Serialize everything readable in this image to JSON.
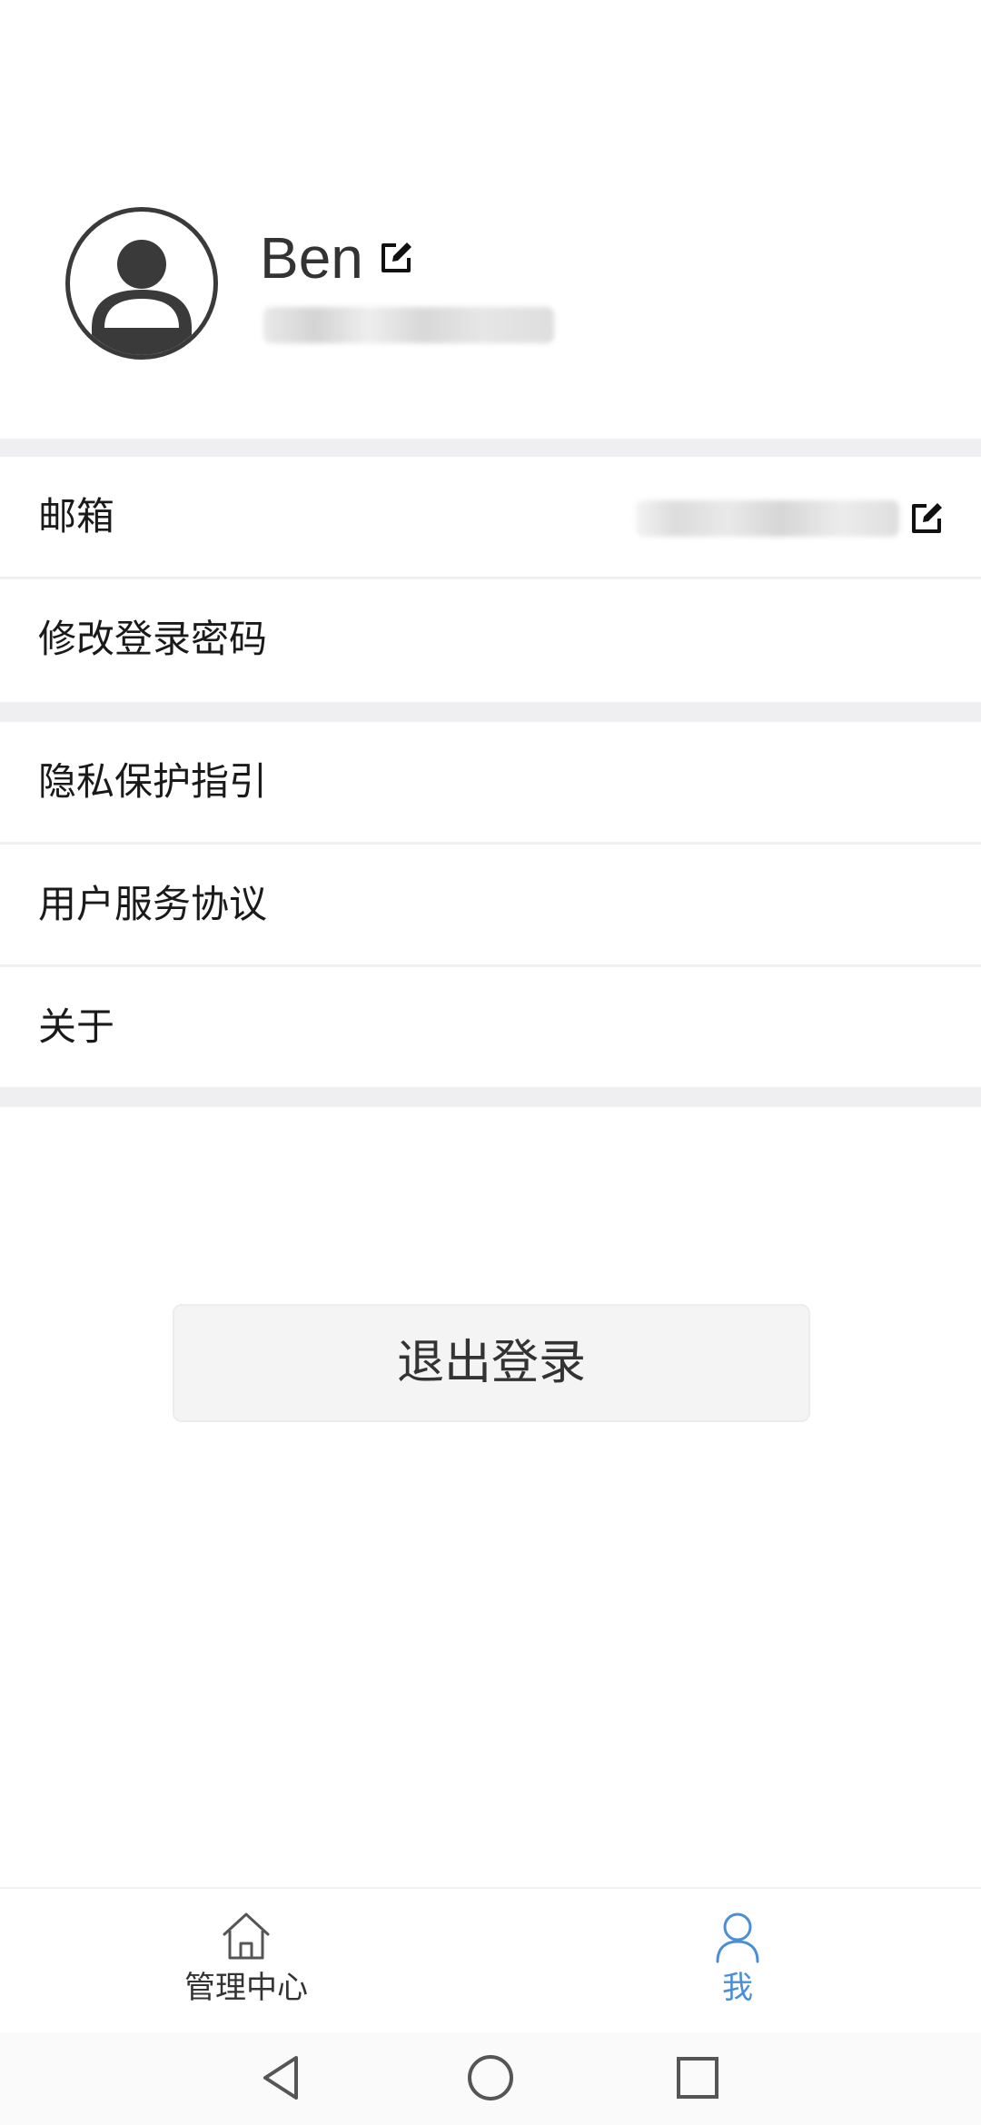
{
  "profile": {
    "username": "Ben",
    "avatar_icon": "user-avatar-icon",
    "edit_icon": "edit-icon"
  },
  "account_section": {
    "email_label": "邮箱",
    "change_password_label": "修改登录密码"
  },
  "info_section": {
    "privacy_label": "隐私保护指引",
    "agreement_label": "用户服务协议",
    "about_label": "关于"
  },
  "logout_label": "退出登录",
  "tabbar": {
    "tabs": [
      {
        "label": "管理中心",
        "icon": "home-icon",
        "active": false
      },
      {
        "label": "我",
        "icon": "user-icon",
        "active": true
      }
    ],
    "active_color": "#4a8fd6",
    "inactive_color": "#333333"
  },
  "system_nav": {
    "back_icon": "back-triangle-icon",
    "home_icon": "home-circle-icon",
    "recent_icon": "recent-square-icon"
  }
}
